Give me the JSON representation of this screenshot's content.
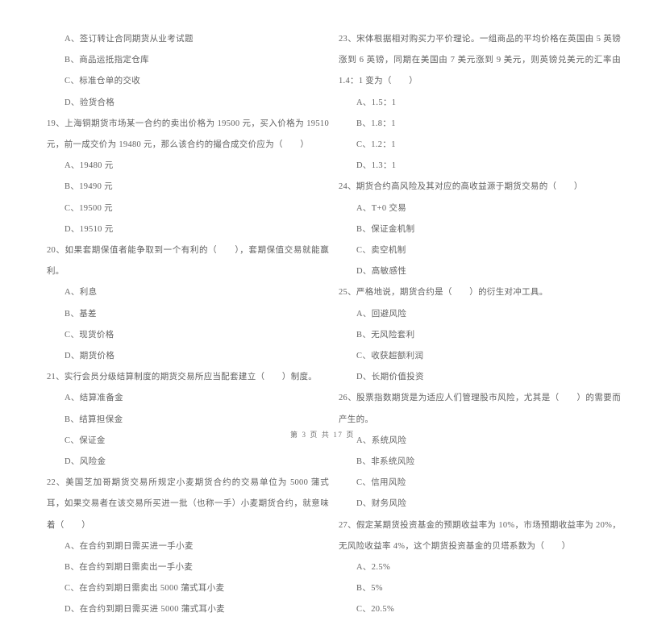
{
  "document": {
    "footer": "第 3 页 共 17 页",
    "page_number": "3",
    "total_pages": "17",
    "text_color": "#616161",
    "background_color": "#ffffff"
  },
  "left_column": {
    "leading_options": [
      "A、签订转让合同期货从业考试题",
      "B、商品运抵指定仓库",
      "C、标准仓单的交收",
      "D、验货合格"
    ],
    "questions": [
      {
        "number": "19",
        "stem": "19、上海铜期货市场某一合约的卖出价格为 19500 元，买入价格为 19510 元，前一成交价为 19480 元，那么该合约的撮合成交价应为（　　）",
        "options": [
          "A、19480 元",
          "B、19490 元",
          "C、19500 元",
          "D、19510 元"
        ]
      },
      {
        "number": "20",
        "stem": "20、如果套期保值者能争取到一个有利的（　　），套期保值交易就能赢利。",
        "options": [
          "A、利息",
          "B、基差",
          "C、现货价格",
          "D、期货价格"
        ]
      },
      {
        "number": "21",
        "stem": "21、实行会员分级结算制度的期货交易所应当配套建立（　　）制度。",
        "options": [
          "A、结算准备金",
          "B、结算担保金",
          "C、保证金",
          "D、风险金"
        ]
      },
      {
        "number": "22",
        "stem": "22、美国芝加哥期货交易所规定小麦期货合约的交易单位为 5000 蒲式耳，如果交易者在该交易所买进一批（也称一手）小麦期货合约，就意味着（　　）",
        "options": [
          "A、在合约到期日需买进一手小麦",
          "B、在合约到期日需卖出一手小麦",
          "C、在合约到期日需卖出 5000 蒲式耳小麦",
          "D、在合约到期日需买进 5000 蒲式耳小麦"
        ]
      }
    ]
  },
  "right_column": {
    "questions": [
      {
        "number": "23",
        "stem": "23、宋体根据相对购买力平价理论。一组商品的平均价格在英国由 5 英镑涨到 6 英镑，同期在美国由 7 美元涨到 9 美元，则英镑兑美元的汇率由 1.4：1 变为（　　）",
        "options": [
          "A、1.5：1",
          "B、1.8：1",
          "C、1.2：1",
          "D、1.3：1"
        ]
      },
      {
        "number": "24",
        "stem": "24、期货合约高风险及其对应的高收益源于期货交易的（　　）",
        "options": [
          "A、T+0 交易",
          "B、保证金机制",
          "C、卖空机制",
          "D、高敏感性"
        ]
      },
      {
        "number": "25",
        "stem": "25、严格地说，期货合约是（　　）的衍生对冲工具。",
        "options": [
          "A、回避风险",
          "B、无风险套利",
          "C、收获超额利润",
          "D、长期价值投资"
        ]
      },
      {
        "number": "26",
        "stem": "26、股票指数期货是为适应人们管理股市风险，尤其是（　　）的需要而产生的。",
        "options": [
          "A、系统风险",
          "B、非系统风险",
          "C、信用风险",
          "D、财务风险"
        ]
      },
      {
        "number": "27",
        "stem": "27、假定某期货投资基金的预期收益率为 10%，市场预期收益率为 20%，无风险收益率 4%，这个期货投资基金的贝塔系数为（　　）",
        "options": [
          "A、2.5%",
          "B、5%",
          "C、20.5%"
        ]
      }
    ]
  }
}
